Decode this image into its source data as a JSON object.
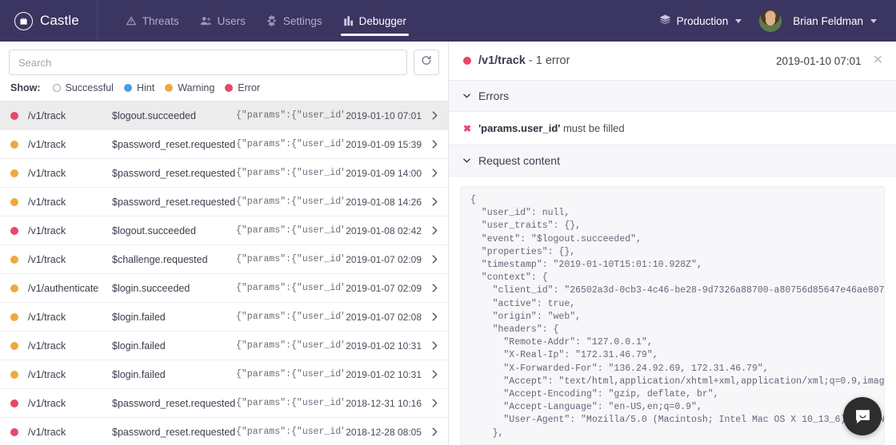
{
  "brand": {
    "name": "Castle",
    "logo_icon": "castle-tower-icon",
    "bg_color": "#3b3561"
  },
  "nav": {
    "items": [
      {
        "label": "Threats",
        "icon": "warning-triangle-icon",
        "active": false
      },
      {
        "label": "Users",
        "icon": "users-icon",
        "active": false
      },
      {
        "label": "Settings",
        "icon": "gear-icon",
        "active": false
      },
      {
        "label": "Debugger",
        "icon": "bar-chart-icon",
        "active": true
      }
    ]
  },
  "topbar_right": {
    "environment": "Production",
    "environment_icon": "layers-icon",
    "user_name": "Brian Feldman",
    "avatar_icon": "avatar"
  },
  "search": {
    "placeholder": "Search",
    "value": "",
    "refresh_icon": "refresh-icon"
  },
  "filters": {
    "show_label": "Show:",
    "options": [
      {
        "label": "Successful",
        "color": "transparent",
        "hollow": true
      },
      {
        "label": "Hint",
        "color": "#4a9fe0",
        "hollow": false
      },
      {
        "label": "Warning",
        "color": "#efa93c",
        "hollow": false
      },
      {
        "label": "Error",
        "color": "#e5496b",
        "hollow": false
      }
    ]
  },
  "colors": {
    "error": "#e5496b",
    "warning": "#efa93c",
    "hint": "#4a9fe0",
    "header_bg": "#3b3561",
    "selected_row": "#ececed"
  },
  "log_rows": [
    {
      "status": "error",
      "color": "#e5496b",
      "endpoint": "/v1/track",
      "event": "$logout.succeeded",
      "params": "{\"params\":{\"user_id\":_",
      "time": "2019-01-10 07:01",
      "selected": true
    },
    {
      "status": "warning",
      "color": "#efa93c",
      "endpoint": "/v1/track",
      "event": "$password_reset.requested",
      "params": "{\"params\":{\"user_id\":_",
      "time": "2019-01-09 15:39",
      "selected": false
    },
    {
      "status": "warning",
      "color": "#efa93c",
      "endpoint": "/v1/track",
      "event": "$password_reset.requested",
      "params": "{\"params\":{\"user_id\":_",
      "time": "2019-01-09 14:00",
      "selected": false
    },
    {
      "status": "warning",
      "color": "#efa93c",
      "endpoint": "/v1/track",
      "event": "$password_reset.requested",
      "params": "{\"params\":{\"user_id\":_",
      "time": "2019-01-08 14:26",
      "selected": false
    },
    {
      "status": "error",
      "color": "#e5496b",
      "endpoint": "/v1/track",
      "event": "$logout.succeeded",
      "params": "{\"params\":{\"user_id\":_",
      "time": "2019-01-08 02:42",
      "selected": false
    },
    {
      "status": "warning",
      "color": "#efa93c",
      "endpoint": "/v1/track",
      "event": "$challenge.requested",
      "params": "{\"params\":{\"user_id\":_",
      "time": "2019-01-07 02:09",
      "selected": false
    },
    {
      "status": "warning",
      "color": "#efa93c",
      "endpoint": "/v1/authenticate",
      "event": "$login.succeeded",
      "params": "{\"params\":{\"user_id\":_",
      "time": "2019-01-07 02:09",
      "selected": false
    },
    {
      "status": "warning",
      "color": "#efa93c",
      "endpoint": "/v1/track",
      "event": "$login.failed",
      "params": "{\"params\":{\"user_id\":_",
      "time": "2019-01-07 02:08",
      "selected": false
    },
    {
      "status": "warning",
      "color": "#efa93c",
      "endpoint": "/v1/track",
      "event": "$login.failed",
      "params": "{\"params\":{\"user_id\":_",
      "time": "2019-01-02 10:31",
      "selected": false
    },
    {
      "status": "warning",
      "color": "#efa93c",
      "endpoint": "/v1/track",
      "event": "$login.failed",
      "params": "{\"params\":{\"user_id\":_",
      "time": "2019-01-02 10:31",
      "selected": false
    },
    {
      "status": "error",
      "color": "#e5496b",
      "endpoint": "/v1/track",
      "event": "$password_reset.requested",
      "params": "{\"params\":{\"user_id\":_",
      "time": "2018-12-31 10:16",
      "selected": false
    },
    {
      "status": "error",
      "color": "#e5496b",
      "endpoint": "/v1/track",
      "event": "$password_reset.requested",
      "params": "{\"params\":{\"user_id\":_",
      "time": "2018-12-28 08:05",
      "selected": false
    }
  ],
  "detail": {
    "status_color": "#e5496b",
    "endpoint": "/v1/track",
    "summary": " - 1 error",
    "timestamp": "2019-01-10 07:01",
    "close_label": "✕",
    "errors_section_title": "Errors",
    "error_mark": "✖",
    "error_field": "'params.user_id'",
    "error_message": " must be filled",
    "request_section_title": "Request content",
    "request_body": "{\n  \"user_id\": null,\n  \"user_traits\": {},\n  \"event\": \"$logout.succeeded\",\n  \"properties\": {},\n  \"timestamp\": \"2019-01-10T15:01:10.928Z\",\n  \"context\": {\n    \"client_id\": \"26502a3d-0cb3-4c46-be28-9d7326a88700-a80756d85647e46ae807e46a\",\n    \"active\": true,\n    \"origin\": \"web\",\n    \"headers\": {\n      \"Remote-Addr\": \"127.0.0.1\",\n      \"X-Real-Ip\": \"172.31.46.79\",\n      \"X-Forwarded-For\": \"136.24.92.69, 172.31.46.79\",\n      \"Accept\": \"text/html,application/xhtml+xml,application/xml;q=0.9,image/webp,image/apn\n      \"Accept-Encoding\": \"gzip, deflate, br\",\n      \"Accept-Language\": \"en-US,en;q=0.9\",\n      \"User-Agent\": \"Mozilla/5.0 (Macintosh; Intel Mac OS X 10_13_6) AppleWebKit/537.3\n    },"
  },
  "intercom": {
    "icon": "chat-bubble-icon"
  }
}
